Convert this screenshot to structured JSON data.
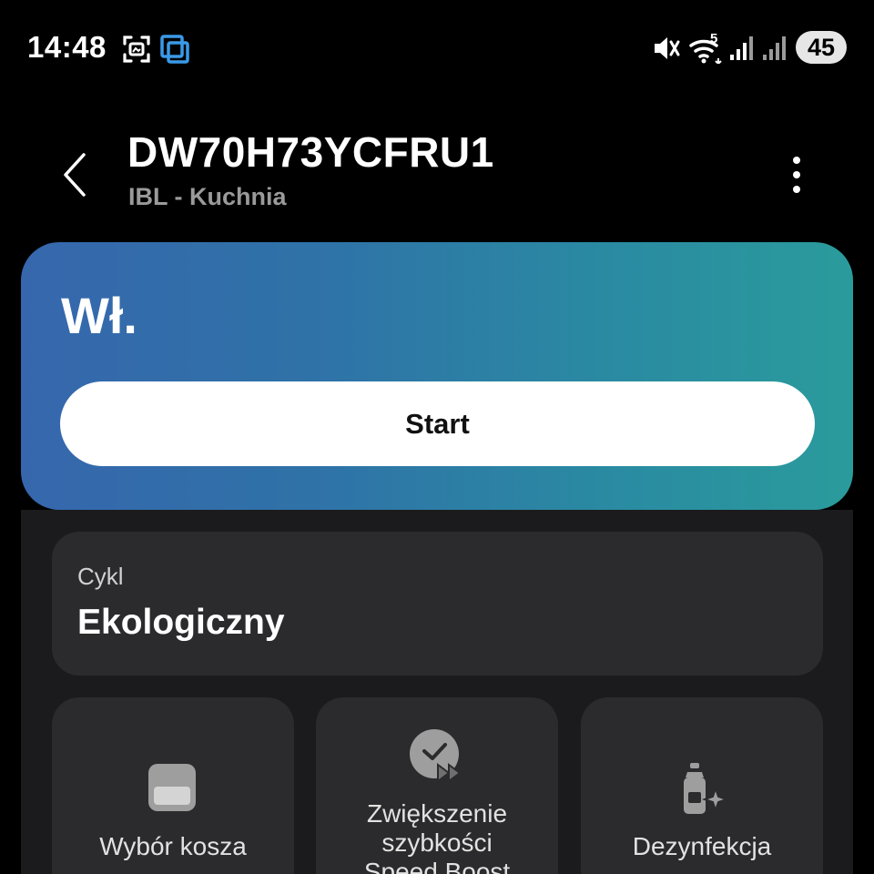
{
  "status_bar": {
    "time": "14:48",
    "battery": "45",
    "icons": [
      "screen-capture-icon",
      "screen-mirror-icon",
      "mute-vibrate-icon",
      "wifi-icon",
      "signal-icon",
      "signal-icon-secondary"
    ],
    "wifi_badge": "5"
  },
  "header": {
    "title": "DW70H73YCFRU1",
    "subtitle": "IBL - Kuchnia"
  },
  "status_card": {
    "status": "Wł.",
    "start_label": "Start"
  },
  "cycle": {
    "label": "Cykl",
    "value": "Ekologiczny"
  },
  "options": [
    {
      "label": "Wybór kosza",
      "icon": "basket-icon"
    },
    {
      "label": "Zwiększenie\nszybkości\nSpeed Boost",
      "icon": "speed-boost-icon"
    },
    {
      "label": "Dezynfekcja",
      "icon": "sanitize-icon"
    }
  ],
  "colors": {
    "background": "#000000",
    "panel": "#1b1b1d",
    "card": "#2b2b2d",
    "gradient_start": "#3667ad",
    "gradient_end": "#2a9b9c",
    "subtitle": "#9a9a9a"
  }
}
